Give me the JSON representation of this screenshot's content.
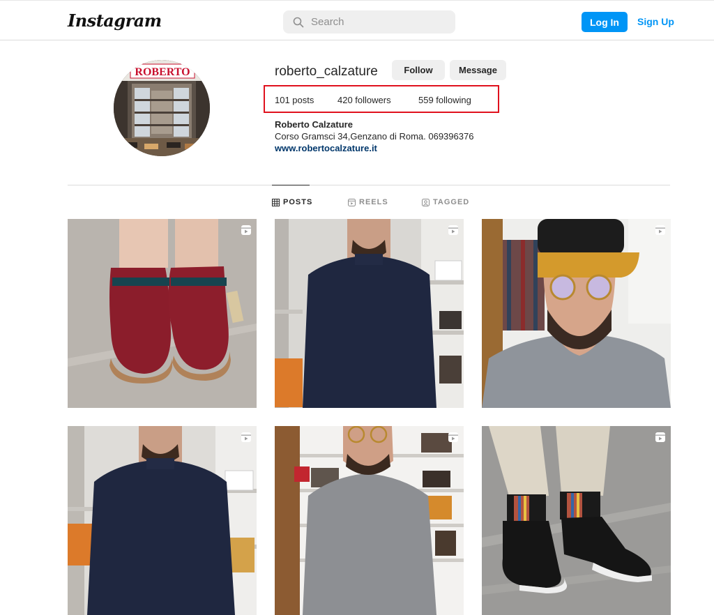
{
  "header": {
    "logo": "Instagram",
    "search_placeholder": "Search",
    "login_label": "Log In",
    "signup_label": "Sign Up"
  },
  "profile": {
    "username": "roberto_calzature",
    "follow_label": "Follow",
    "message_label": "Message",
    "stats": {
      "posts": "101 posts",
      "followers": "420 followers",
      "following": "559 following"
    },
    "bio_name": "Roberto Calzature",
    "bio_text": "Corso Gramsci 34,Genzano di Roma. 069396376",
    "bio_link": "www.robertocalzature.it",
    "avatar_sign": "ROBERTO"
  },
  "tabs": [
    {
      "label": "POSTS",
      "icon": "grid-icon",
      "active": true
    },
    {
      "label": "REELS",
      "icon": "reels-icon",
      "active": false
    },
    {
      "label": "TAGGED",
      "icon": "tagged-icon",
      "active": false
    }
  ],
  "posts": [
    {
      "subject": "red felt clogs",
      "icon": "reel-icon"
    },
    {
      "subject": "man in navy sweater",
      "icon": "reel-icon"
    },
    {
      "subject": "man with cap and glasses",
      "icon": "reel-icon"
    },
    {
      "subject": "man in navy sweater",
      "icon": "reel-icon"
    },
    {
      "subject": "man in grey sweater",
      "icon": "reel-icon"
    },
    {
      "subject": "black chelsea boots",
      "icon": "reel-icon"
    }
  ],
  "colors": {
    "accent": "#0095f6",
    "highlight_box": "#e0111d",
    "link": "#00376b"
  }
}
